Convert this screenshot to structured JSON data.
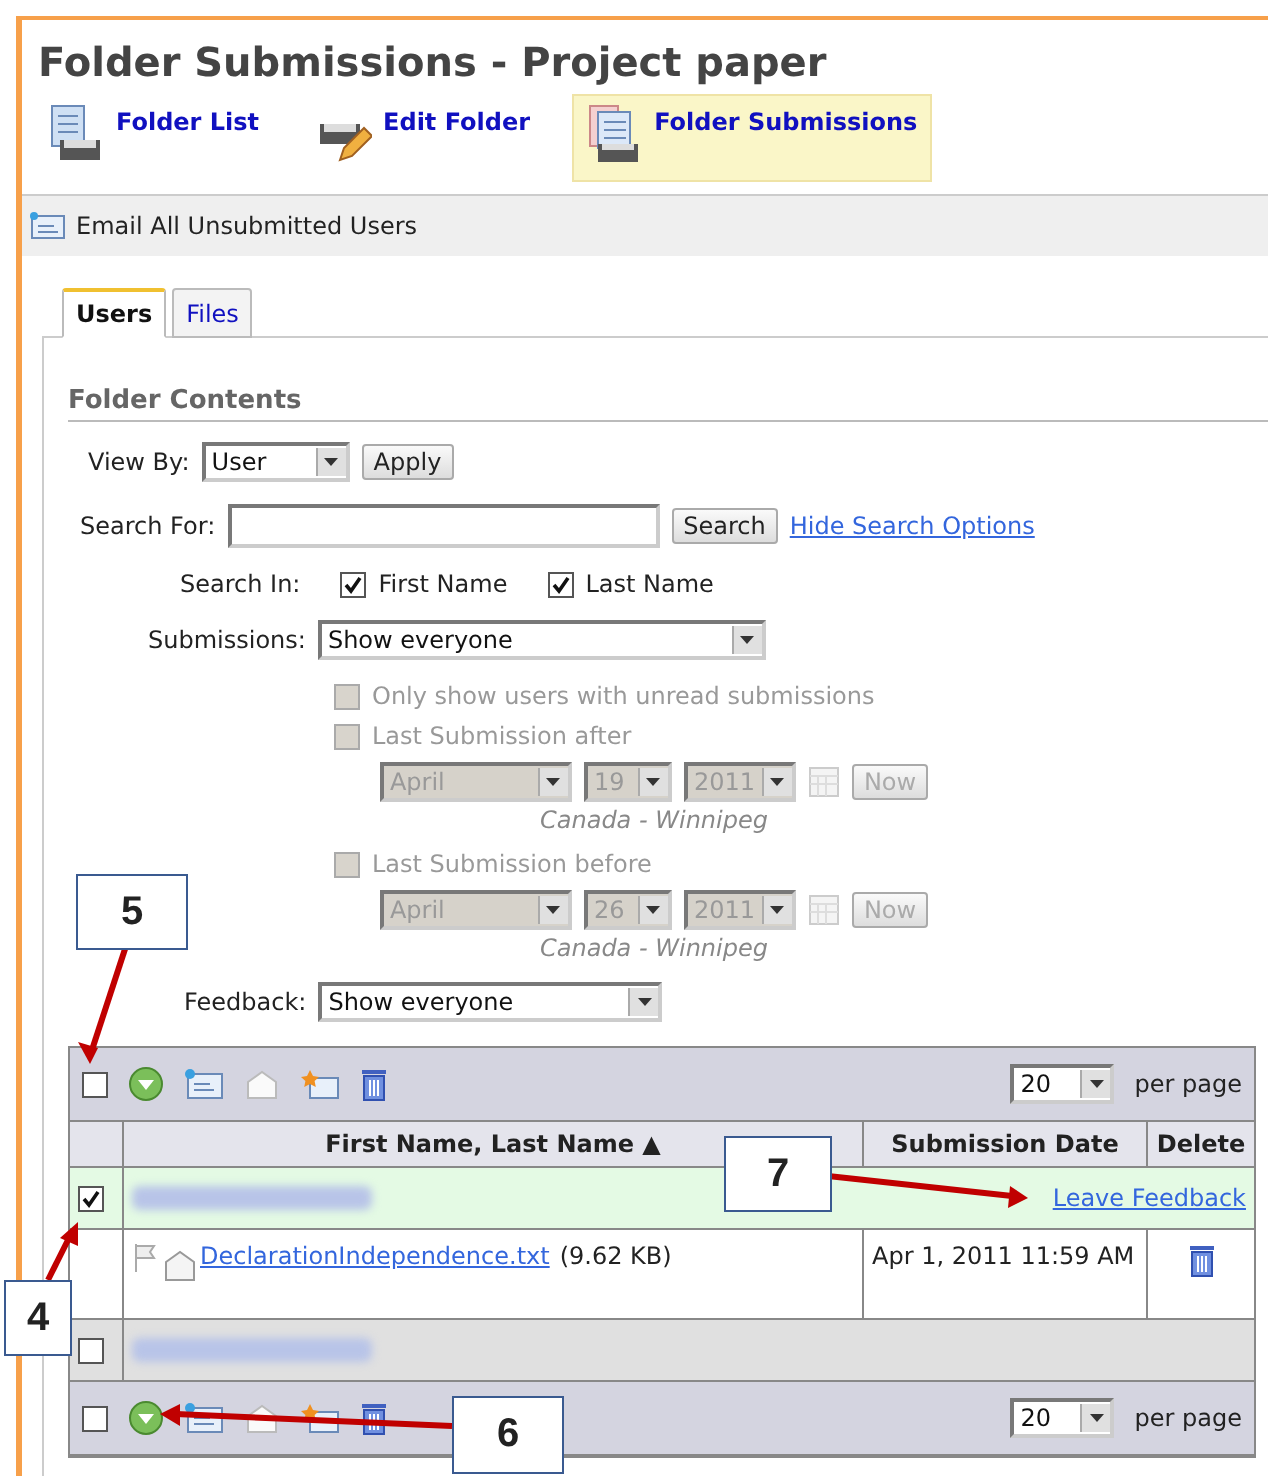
{
  "title": "Folder Submissions - Project paper",
  "nav": [
    {
      "label": "Folder List",
      "kind": "list",
      "selected": false
    },
    {
      "label": "Edit Folder",
      "kind": "edit",
      "selected": false
    },
    {
      "label": "Folder Submissions",
      "kind": "submissions",
      "selected": true
    }
  ],
  "action_bar": {
    "label": "Email All Unsubmitted Users"
  },
  "tabs": [
    {
      "label": "Users",
      "selected": true
    },
    {
      "label": "Files",
      "selected": false
    }
  ],
  "section_title": "Folder Contents",
  "view_by": {
    "label": "View By:",
    "value": "User",
    "button": "Apply"
  },
  "search": {
    "label": "Search For:",
    "button": "Search",
    "link": "Hide Search Options"
  },
  "search_in": {
    "label": "Search In:",
    "options": [
      {
        "label": "First Name",
        "checked": true
      },
      {
        "label": "Last Name",
        "checked": true
      }
    ]
  },
  "submissions": {
    "label": "Submissions:",
    "value": "Show everyone"
  },
  "filters": [
    {
      "label": "Only show users with unread submissions",
      "checked": false,
      "disabled": true
    },
    {
      "label": "Last Submission after",
      "checked": false,
      "disabled": true,
      "date": {
        "month": "April",
        "day": "19",
        "year": "2011",
        "button": "Now",
        "zone": "Canada - Winnipeg"
      }
    },
    {
      "label": "Last Submission before",
      "checked": false,
      "disabled": true,
      "date": {
        "month": "April",
        "day": "26",
        "year": "2011",
        "button": "Now",
        "zone": "Canada - Winnipeg"
      }
    }
  ],
  "feedback": {
    "label": "Feedback:",
    "value": "Show everyone"
  },
  "toolbars": [
    {
      "checked": false,
      "per_page": "20",
      "per_page_label": "per page"
    },
    {
      "checked": false,
      "per_page": "20",
      "per_page_label": "per page"
    }
  ],
  "table": {
    "columns": [
      "First Name, Last Name ▲",
      "Submission Date",
      "Delete"
    ],
    "rows": [
      {
        "kind": "user",
        "checked": true,
        "link": "Leave Feedback"
      },
      {
        "kind": "file",
        "file": "DeclarationIndependence.txt",
        "size": "(9.62 KB)",
        "date": "Apr 1, 2011 11:59 AM"
      },
      {
        "kind": "user",
        "checked": false
      }
    ]
  },
  "callouts": [
    {
      "label": "5"
    },
    {
      "label": "4"
    },
    {
      "label": "7"
    },
    {
      "label": "6"
    }
  ]
}
